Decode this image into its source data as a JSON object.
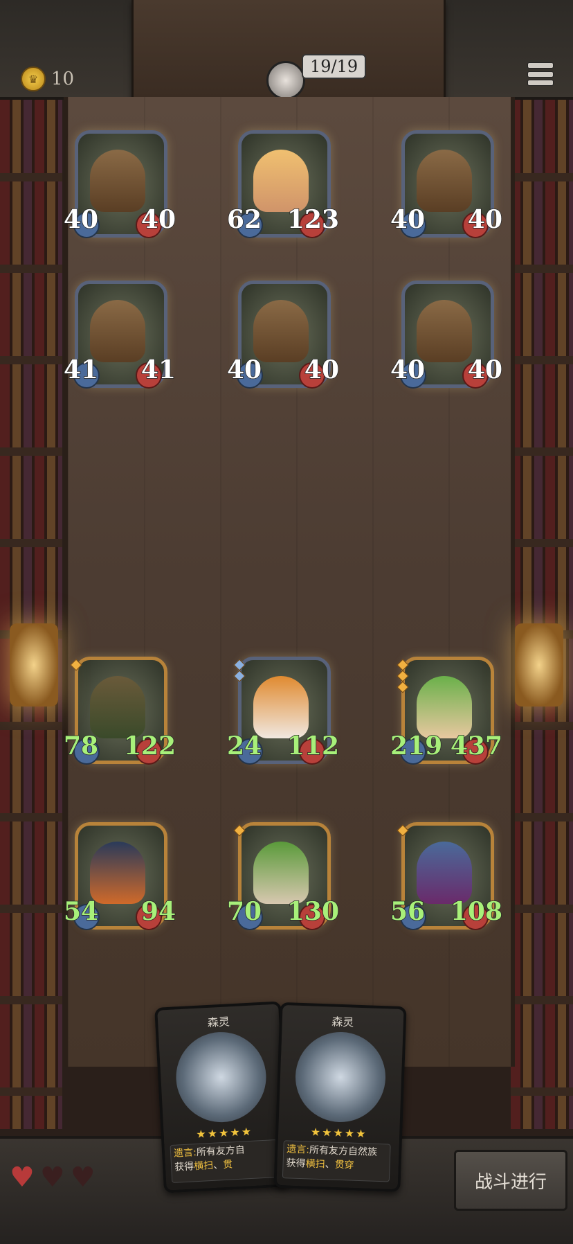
{
  "top": {
    "gold": "10",
    "unit_counter": "19/19"
  },
  "enemy_units": [
    {
      "atk": "40",
      "hp": "40"
    },
    {
      "atk": "62",
      "hp": "123"
    },
    {
      "atk": "40",
      "hp": "40"
    },
    {
      "atk": "41",
      "hp": "41"
    },
    {
      "atk": "40",
      "hp": "40"
    },
    {
      "atk": "40",
      "hp": "40"
    }
  ],
  "ally_units": [
    {
      "atk": "78",
      "hp": "122"
    },
    {
      "atk": "24",
      "hp": "112"
    },
    {
      "atk": "219",
      "hp": "437"
    },
    {
      "atk": "54",
      "hp": "94"
    },
    {
      "atk": "70",
      "hp": "130"
    },
    {
      "atk": "56",
      "hp": "108"
    }
  ],
  "hand_cards": [
    {
      "title": "森灵",
      "label": "遗言:",
      "text1": "所有友方自",
      "text2": "获得",
      "kw1": "横扫",
      "sep": "、",
      "kw2": "贯"
    },
    {
      "title": "森灵",
      "label": "遗言:",
      "text1": "所有友方自然族",
      "text2": "获得",
      "kw1": "横扫",
      "sep": "、",
      "kw2": "贯穿"
    }
  ],
  "card_stars": "★★★★★",
  "lives": {
    "full": 1,
    "total": 3
  },
  "battle_button": "战斗进行"
}
